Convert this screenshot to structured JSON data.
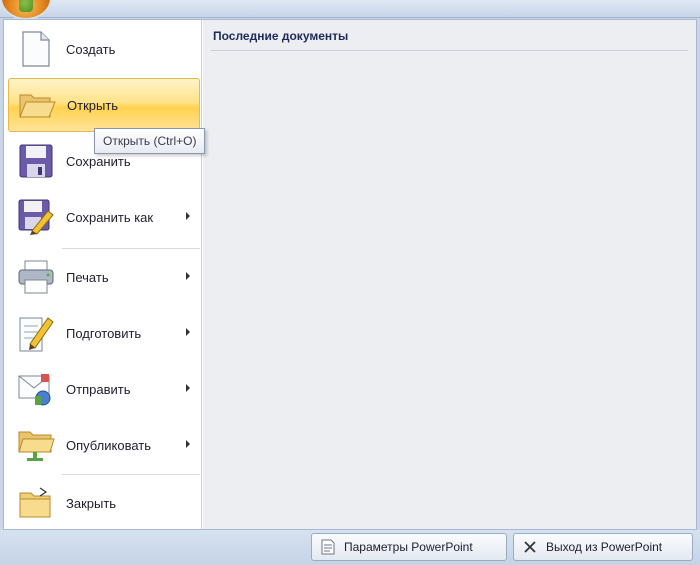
{
  "menu": {
    "items": [
      {
        "label": "Создать",
        "icon": "new-document-icon",
        "submenu": false
      },
      {
        "label": "Открыть",
        "icon": "open-folder-icon",
        "submenu": false,
        "highlighted": true
      },
      {
        "label": "Сохранить",
        "icon": "save-disk-icon",
        "submenu": false
      },
      {
        "label": "Сохранить как",
        "icon": "save-as-icon",
        "submenu": true
      },
      {
        "label": "Печать",
        "icon": "printer-icon",
        "submenu": true
      },
      {
        "label": "Подготовить",
        "icon": "prepare-pencil-icon",
        "submenu": true
      },
      {
        "label": "Отправить",
        "icon": "send-icon",
        "submenu": true
      },
      {
        "label": "Опубликовать",
        "icon": "publish-folder-icon",
        "submenu": true
      },
      {
        "label": "Закрыть",
        "icon": "close-folder-icon",
        "submenu": false
      }
    ],
    "tooltip": "Открыть (Ctrl+O)"
  },
  "recent": {
    "title": "Последние документы"
  },
  "footer": {
    "options_label": "Параметры PowerPoint",
    "exit_label": "Выход из PowerPoint"
  },
  "colors": {
    "highlight": "#ffd24f",
    "panel_right": "#eceef2",
    "title_text": "#1f2a57"
  }
}
